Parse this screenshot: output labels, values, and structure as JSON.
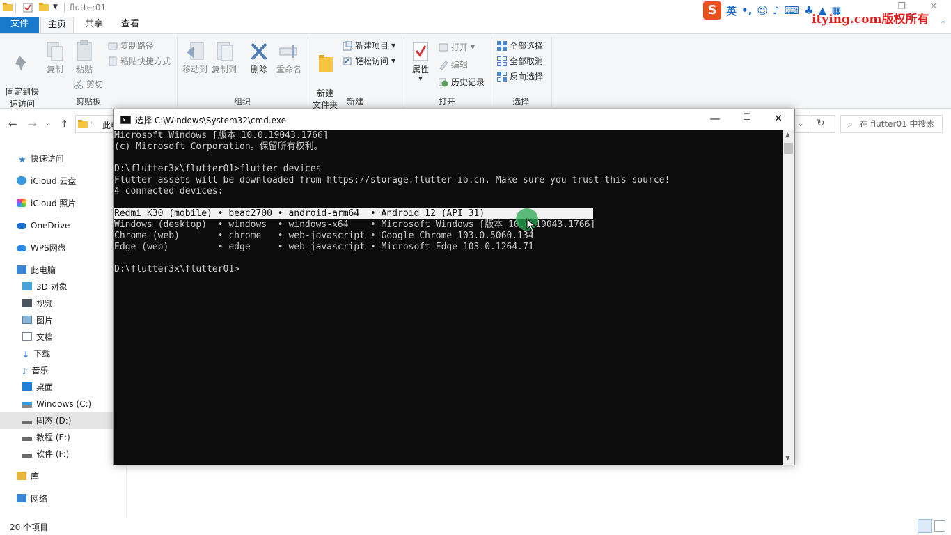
{
  "explorer": {
    "window_title": "flutter01",
    "tabs": [
      "文件",
      "主页",
      "共享",
      "查看"
    ],
    "ribbon": {
      "clipboard": {
        "pin_label": "固定到快\n速访问",
        "copy_label": "复制",
        "paste_label": "粘贴",
        "copy_path_label": "复制路径",
        "paste_shortcut_label": "粘贴快捷方式",
        "cut_label": "剪切",
        "group_label": "剪贴板"
      },
      "organize": {
        "move_to_label": "移动到",
        "copy_to_label": "复制到",
        "delete_label": "删除",
        "rename_label": "重命名",
        "group_label": "组织"
      },
      "new": {
        "new_folder_label": "新建\n文件夹",
        "new_item_label": "新建项目",
        "easy_access_label": "轻松访问",
        "group_label": "新建"
      },
      "open": {
        "properties_label": "属性",
        "open_label": "打开",
        "edit_label": "编辑",
        "history_label": "历史记录",
        "group_label": "打开"
      },
      "select": {
        "select_all_label": "全部选择",
        "select_none_label": "全部取消",
        "invert_label": "反向选择",
        "group_label": "选择"
      }
    },
    "address_partial": "此电",
    "search_placeholder": "在 flutter01 中搜索",
    "nav": {
      "quick_access": "快速访问",
      "icloud_drive": "iCloud 云盘",
      "icloud_photos": "iCloud 照片",
      "onedrive": "OneDrive",
      "wps": "WPS网盘",
      "this_pc": "此电脑",
      "objects_3d": "3D 对象",
      "videos": "视频",
      "pictures": "图片",
      "documents": "文档",
      "downloads": "下载",
      "music": "音乐",
      "desktop": "桌面",
      "drive_c": "Windows (C:)",
      "drive_d": "固态 (D:)",
      "drive_e": "教程 (E:)",
      "drive_f": "软件 (F:)",
      "libraries": "库",
      "network": "网络"
    },
    "status_text": "20 个项目"
  },
  "ime": {
    "lang": "英"
  },
  "watermark": "itying.com版权所有",
  "cmd": {
    "title": "选择 C:\\Windows\\System32\\cmd.exe",
    "lines": [
      "Microsoft Windows [版本 10.0.19043.1766]",
      "(c) Microsoft Corporation。保留所有权利。",
      "",
      "D:\\flutter3x\\flutter01>flutter devices",
      "Flutter assets will be downloaded from https://storage.flutter-io.cn. Make sure you trust this source!",
      "4 connected devices:",
      "",
      "Redmi K30 (mobile) • beac2700 • android-arm64  • Android 12 (API 31)",
      "Windows (desktop)  • windows  • windows-x64    • Microsoft Windows [版本 10.0.19043.1766]",
      "Chrome (web)       • chrome   • web-javascript • Google Chrome 103.0.5060.134",
      "Edge (web)         • edge     • web-javascript • Microsoft Edge 103.0.1264.71",
      "",
      "D:\\flutter3x\\flutter01>"
    ]
  }
}
